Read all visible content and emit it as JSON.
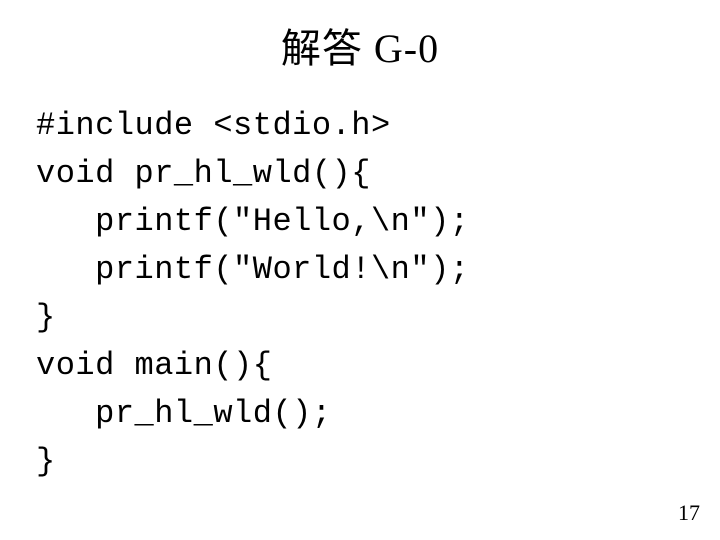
{
  "title": "解答 G-0",
  "code": {
    "l1": "#include <stdio.h>",
    "l2": "void pr_hl_wld(){",
    "l3": "   printf(\"Hello,\\n\");",
    "l4": "   printf(\"World!\\n\");",
    "l5": "}",
    "l6": "void main(){",
    "l7": "   pr_hl_wld();",
    "l8": "}"
  },
  "page_number": "17"
}
